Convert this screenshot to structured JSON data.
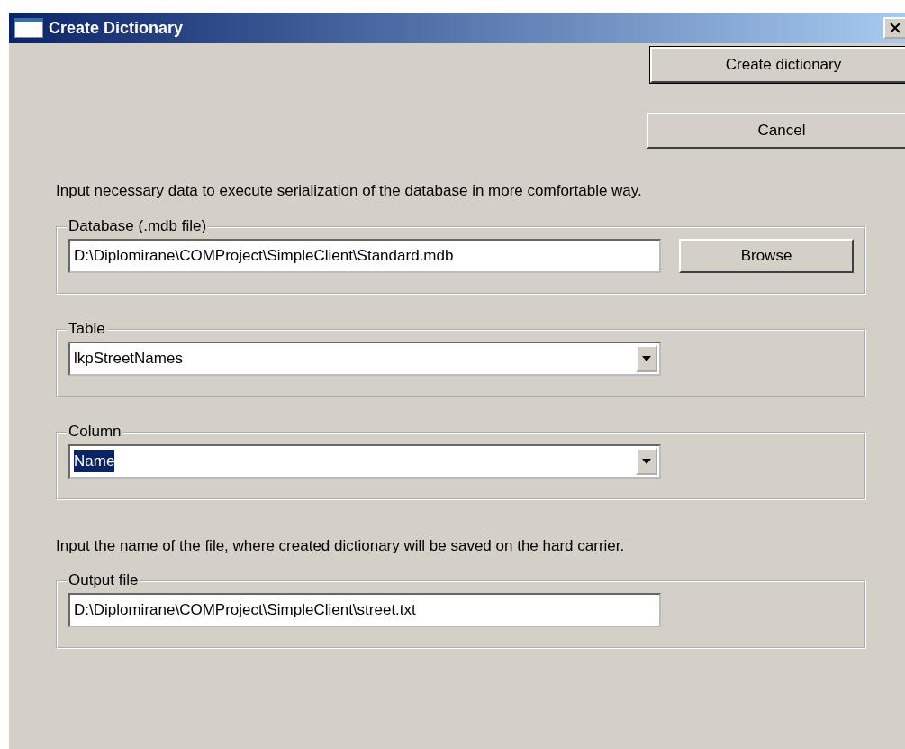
{
  "window": {
    "title": "Create Dictionary"
  },
  "buttons": [
    {
      "label": "Create dictionary",
      "default": true
    },
    {
      "label": "Cancel",
      "default": false
    }
  ],
  "intro": "Input necessary data to execute serialization of the database in more comfortable way.",
  "groups": [
    {
      "legend": "Database (.mdb file)",
      "kind": "text",
      "value": "D:\\Diplomirane\\COMProject\\SimpleClient\\Standard.mdb",
      "button": "Browse",
      "text_selected": false
    },
    {
      "legend": "Table",
      "kind": "combo",
      "value": "lkpStreetNames",
      "text_selected": false
    },
    {
      "legend": "Column",
      "kind": "combo",
      "value": "Name",
      "text_selected": true
    }
  ],
  "output_hint": "Input the name of the file, where created dictionary will be saved on the hard carrier.",
  "output": {
    "legend": "Output file",
    "kind": "text",
    "value": "D:\\Diplomirane\\COMProject\\SimpleClient\\street.txt",
    "text_selected": false
  }
}
